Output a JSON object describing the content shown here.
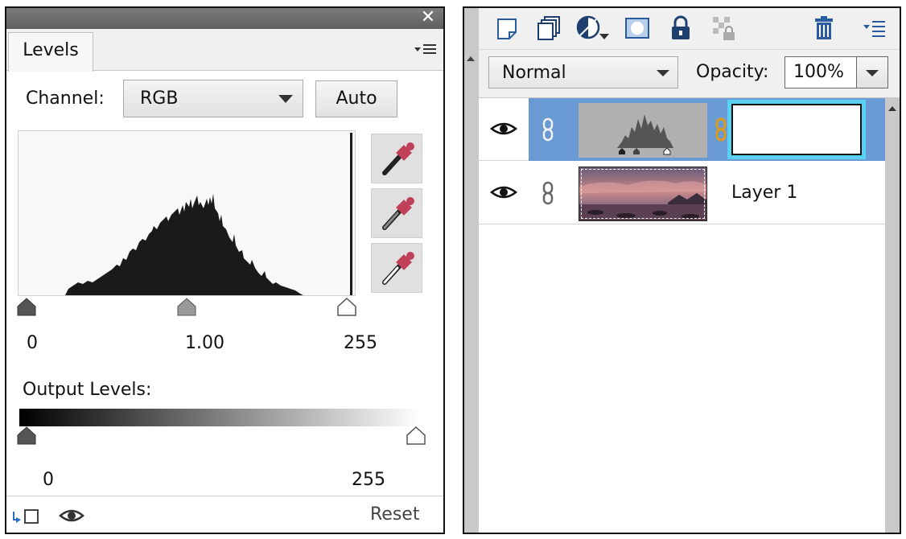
{
  "levels_panel": {
    "tab_label": "Levels",
    "close_glyph": "✕",
    "channel_label": "Channel:",
    "channel_value": "RGB",
    "auto_label": "Auto",
    "input_levels": {
      "black": "0",
      "gamma": "1.00",
      "white": "255"
    },
    "output_levels_label": "Output Levels:",
    "output_levels": {
      "black": "0",
      "white": "255"
    },
    "reset_label": "Reset",
    "eyedroppers": [
      "black-point-eyedropper-icon",
      "gray-point-eyedropper-icon",
      "white-point-eyedropper-icon"
    ],
    "colors": {
      "titlebar": "#6a6a6a",
      "histogram_fill": "#1a1a1a",
      "dropper_tip": "#c0405a"
    }
  },
  "layers_panel": {
    "toolbar_icons": [
      "new-layer-icon",
      "new-group-icon",
      "adjustment-layer-icon",
      "layer-mask-icon",
      "lock-all-icon",
      "lock-transparency-icon",
      "delete-layer-icon",
      "panel-menu-icon"
    ],
    "blend_mode": "Normal",
    "opacity_label": "Opacity:",
    "opacity_value": "100%",
    "layers": [
      {
        "name": "",
        "type": "levels-adjustment",
        "selected": true,
        "visible": true
      },
      {
        "name": "Layer 1",
        "type": "image",
        "selected": false,
        "visible": true
      }
    ],
    "colors": {
      "selection": "#6a9ad4",
      "mask_highlight": "#5ad0f2",
      "link_chain": "#d89a20"
    }
  }
}
